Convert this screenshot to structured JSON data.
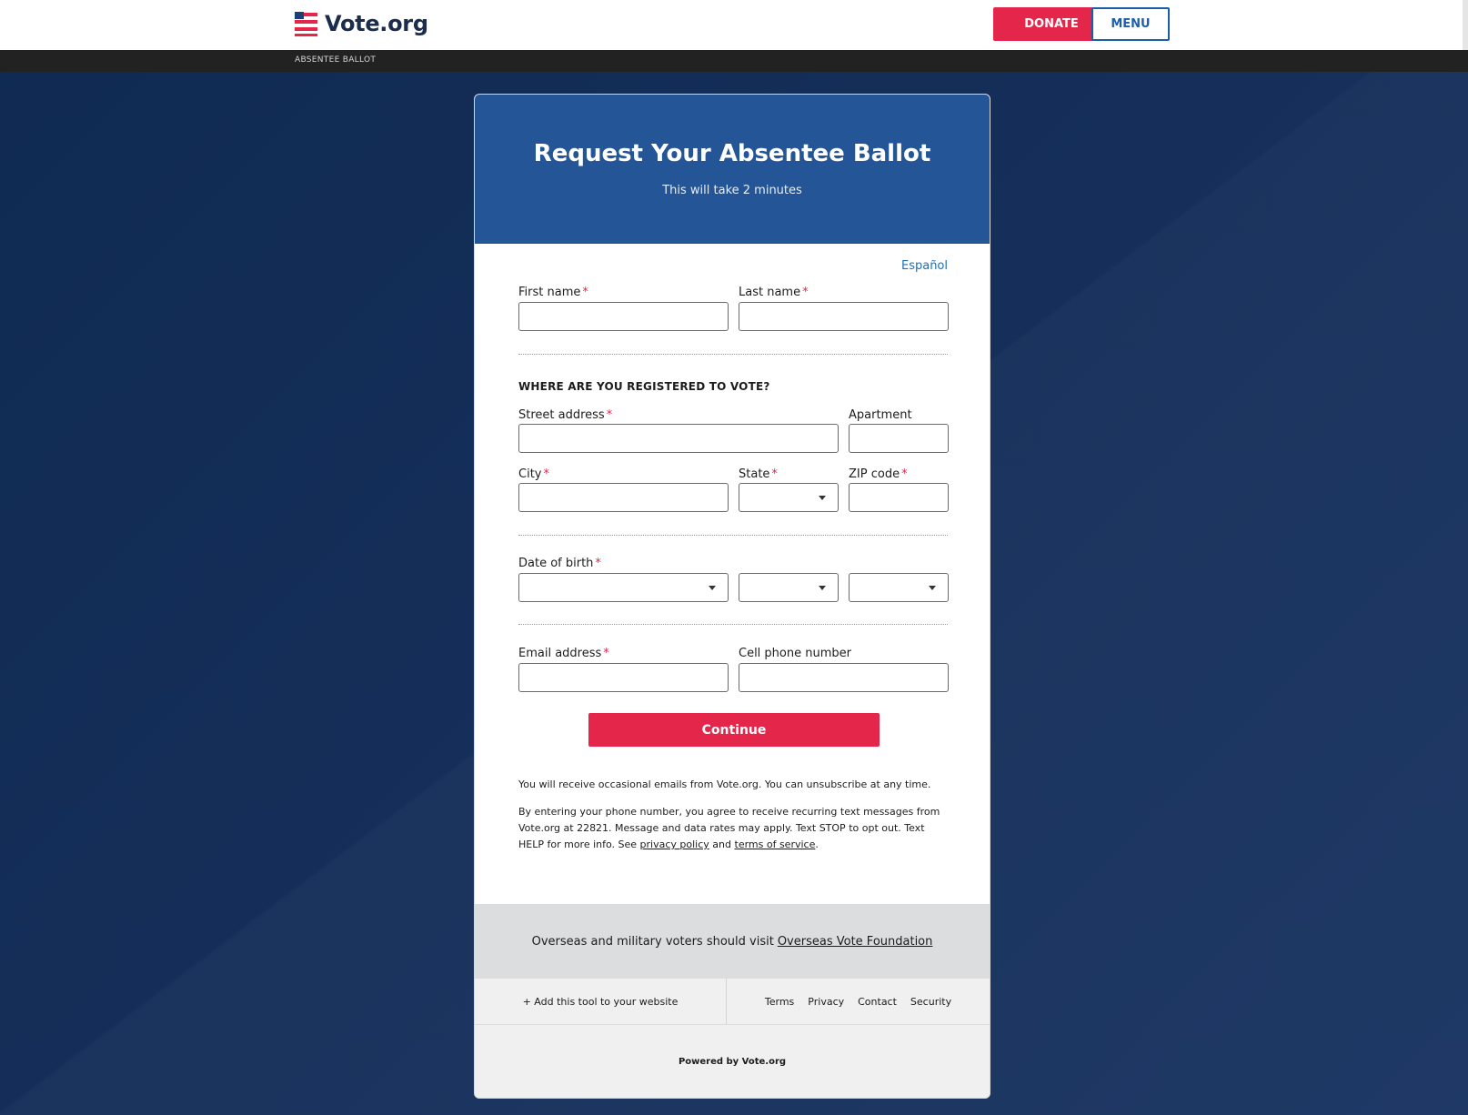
{
  "header": {
    "logo_text": "Vote.org",
    "donate_label": "DONATE",
    "menu_label": "MENU"
  },
  "breadcrumb": "ABSENTEE BALLOT",
  "card": {
    "title": "Request Your Absentee Ballot",
    "subtitle": "This will take 2 minutes",
    "language_link": "Español"
  },
  "form": {
    "required_mark": "*",
    "first_name": {
      "label": "First name",
      "value": ""
    },
    "last_name": {
      "label": "Last name",
      "value": ""
    },
    "section_registered": "WHERE ARE YOU REGISTERED TO VOTE?",
    "street": {
      "label": "Street address",
      "value": ""
    },
    "apartment": {
      "label": "Apartment",
      "value": ""
    },
    "city": {
      "label": "City",
      "value": ""
    },
    "state": {
      "label": "State",
      "value": ""
    },
    "zip": {
      "label": "ZIP code",
      "value": ""
    },
    "dob": {
      "label": "Date of birth",
      "month": "",
      "day": "",
      "year": ""
    },
    "email": {
      "label": "Email address",
      "value": ""
    },
    "phone": {
      "label": "Cell phone number",
      "value": ""
    },
    "continue_label": "Continue"
  },
  "disclaimer": {
    "emails": "You will receive occasional emails from Vote.org. You can unsubscribe at any time.",
    "sms_text": "By entering your phone number, you agree to receive recurring text messages from Vote.org at 22821. Message and data rates may apply. Text STOP to opt out. Text HELP for more info. See ",
    "privacy_link": "privacy policy",
    "and": " and ",
    "terms_link": "terms of service",
    "end": "."
  },
  "overseas": {
    "text": "Overseas and military voters should visit",
    "link": "Overseas Vote Foundation"
  },
  "footer": {
    "add_tool": "+ Add this tool to your website",
    "links": [
      "Terms",
      "Privacy",
      "Contact",
      "Security"
    ],
    "powered": "Powered by Vote.org"
  },
  "colors": {
    "brand_red": "#e4264b",
    "brand_blue": "#245596",
    "background": "#132c55"
  }
}
